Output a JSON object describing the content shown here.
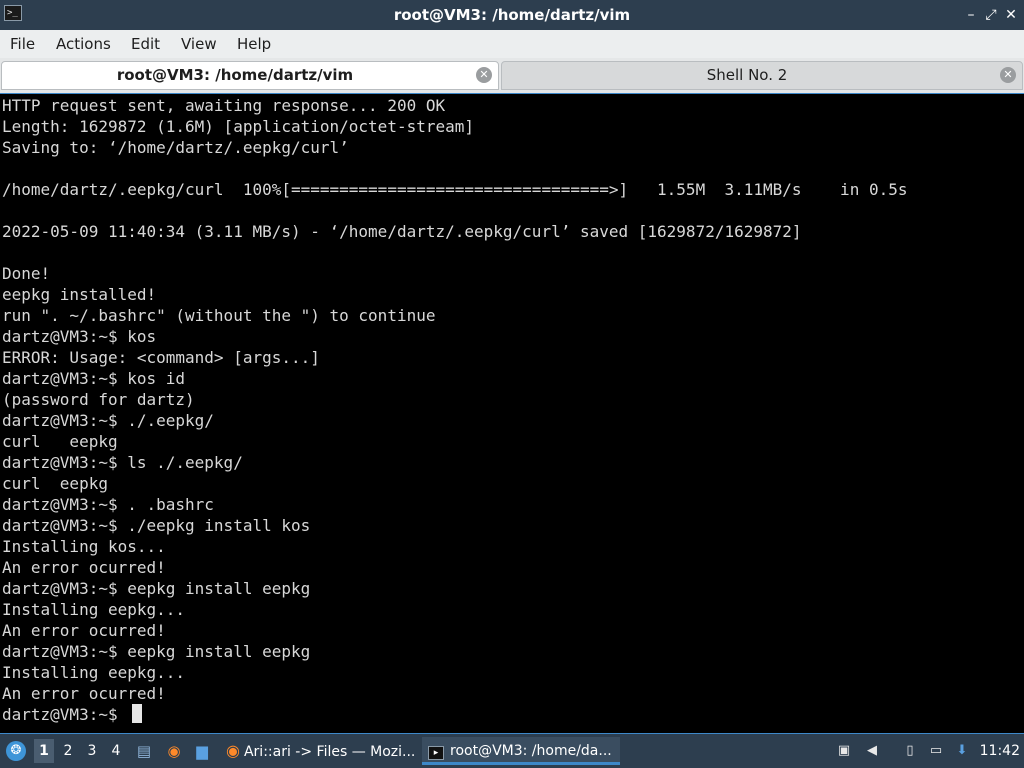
{
  "window": {
    "title": "root@VM3: /home/dartz/vim",
    "app_icon": "terminal-icon",
    "app_icon_glyph": ">_",
    "controls": {
      "minimize": "–",
      "restore": "⤢",
      "close": "✕"
    }
  },
  "menu": {
    "items": [
      "File",
      "Actions",
      "Edit",
      "View",
      "Help"
    ]
  },
  "tabs": [
    {
      "label": "root@VM3: /home/dartz/vim",
      "active": true
    },
    {
      "label": "Shell No. 2",
      "active": false
    }
  ],
  "tab_close_glyph": "✕",
  "terminal": {
    "lines": [
      "HTTP request sent, awaiting response... 200 OK",
      "Length: 1629872 (1.6M) [application/octet-stream]",
      "Saving to: ‘/home/dartz/.eepkg/curl’",
      "",
      "/home/dartz/.eepkg/curl  100%[=================================>]   1.55M  3.11MB/s    in 0.5s",
      "",
      "2022-05-09 11:40:34 (3.11 MB/s) - ‘/home/dartz/.eepkg/curl’ saved [1629872/1629872]",
      "",
      "Done!",
      "eepkg installed!",
      "run \". ~/.bashrc\" (without the \") to continue",
      "dartz@VM3:~$ kos",
      "ERROR: Usage: <command> [args...]",
      "dartz@VM3:~$ kos id",
      "(password for dartz)",
      "dartz@VM3:~$ ./.eepkg/",
      "curl   eepkg",
      "dartz@VM3:~$ ls ./.eepkg/",
      "curl  eepkg",
      "dartz@VM3:~$ . .bashrc",
      "dartz@VM3:~$ ./eepkg install kos",
      "Installing kos...",
      "An error ocurred!",
      "dartz@VM3:~$ eepkg install eepkg",
      "Installing eepkg...",
      "An error ocurred!",
      "dartz@VM3:~$ eepkg install eepkg",
      "Installing eepkg...",
      "An error ocurred!",
      "dartz@VM3:~$ "
    ]
  },
  "taskbar": {
    "start_icon": "lxqt-start-icon",
    "start_glyph": "❂",
    "workspaces": [
      "1",
      "2",
      "3",
      "4"
    ],
    "current_workspace": "1",
    "launchers": [
      {
        "icon": "file-manager-icon",
        "glyph": "▤"
      },
      {
        "icon": "firefox-icon",
        "glyph": "◉"
      },
      {
        "icon": "show-desktop-icon",
        "glyph": "▆"
      }
    ],
    "tasks": [
      {
        "icon": "firefox-icon",
        "glyph": "◉",
        "label": "Ari::ari -> Files — Mozi...",
        "active": false
      },
      {
        "icon": "terminal-icon",
        "glyph": "▸",
        "label": "root@VM3: /home/da...",
        "active": true
      }
    ],
    "tray": [
      {
        "icon": "screenshot-icon",
        "glyph": "▣"
      },
      {
        "icon": "volume-icon",
        "glyph": "◀"
      },
      {
        "icon": "clipboard-icon",
        "glyph": "▯"
      },
      {
        "icon": "network-icon",
        "glyph": "▭"
      },
      {
        "icon": "update-notifier-icon",
        "glyph": "⬇"
      }
    ],
    "clock": "11:42"
  }
}
